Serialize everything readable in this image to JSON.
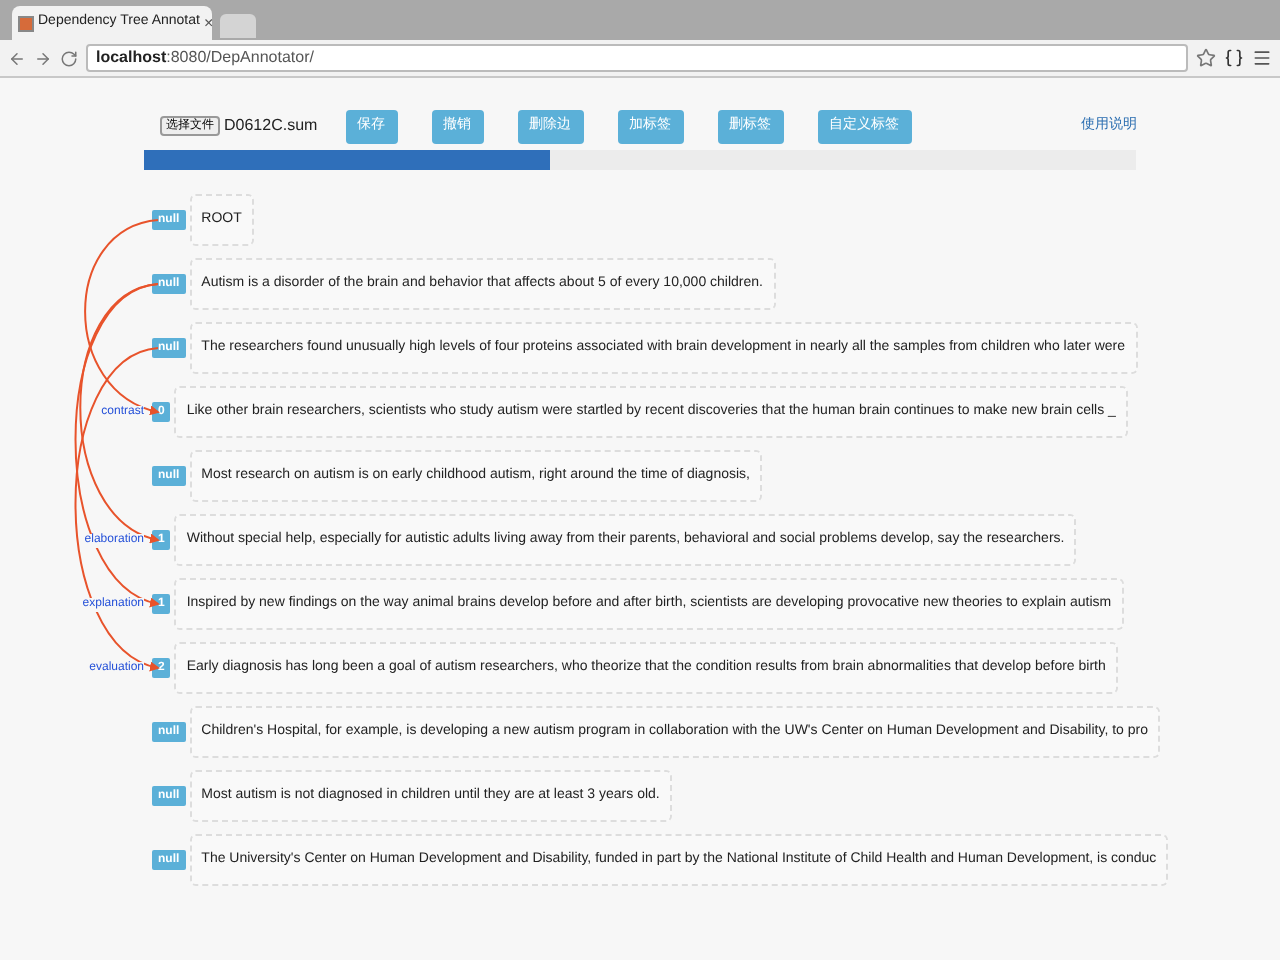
{
  "browser": {
    "tab_title": "Dependency Tree Annotat",
    "tab_close": "×",
    "address_host": "localhost",
    "address_path": ":8080/DepAnnotator/"
  },
  "toolbar": {
    "file_button": "选择文件",
    "file_name": "D0612C.sum",
    "buttons": [
      "保存",
      "撤销",
      "删除边",
      "加标签",
      "删标签",
      "自定义标签"
    ],
    "help_link": "使用说明"
  },
  "progress": {
    "level": 0.41
  },
  "rows": [
    {
      "head": "null",
      "relation": "",
      "text": "ROOT"
    },
    {
      "head": "null",
      "relation": "",
      "text": "Autism is a disorder of the brain and behavior that affects about 5 of every 10,000 children."
    },
    {
      "head": "null",
      "relation": "",
      "text": "The researchers found unusually high levels of four proteins associated with brain development in nearly all the samples from children who later were"
    },
    {
      "head": "0",
      "relation": "contrast",
      "text": "Like other brain researchers, scientists who study autism were startled by recent discoveries that the human brain continues to make new brain cells _"
    },
    {
      "head": "null",
      "relation": "",
      "text": "Most research on autism is on early childhood autism, right around the time of diagnosis,"
    },
    {
      "head": "1",
      "relation": "elaboration",
      "text": "Without special help, especially for autistic adults living away from their parents, behavioral and social problems develop, say the researchers."
    },
    {
      "head": "1",
      "relation": "explanation",
      "text": "Inspired by new findings on the way animal brains develop before and after birth, scientists are developing provocative new theories to explain autism"
    },
    {
      "head": "2",
      "relation": "evaluation",
      "text": "Early diagnosis has long been a goal of autism researchers, who theorize that the condition results from brain abnormalities that develop before birth"
    },
    {
      "head": "null",
      "relation": "",
      "text": "Children's Hospital, for example, is developing a new autism program in collaboration with the UW's Center on Human Development and Disability, to pro"
    },
    {
      "head": "null",
      "relation": "",
      "text": "Most autism is not diagnosed in children until they are at least 3 years old."
    },
    {
      "head": "null",
      "relation": "",
      "text": "The University's Center on Human Development and Disability, funded in part by the National Institute of Child Health and Human Development, is conduc"
    }
  ]
}
